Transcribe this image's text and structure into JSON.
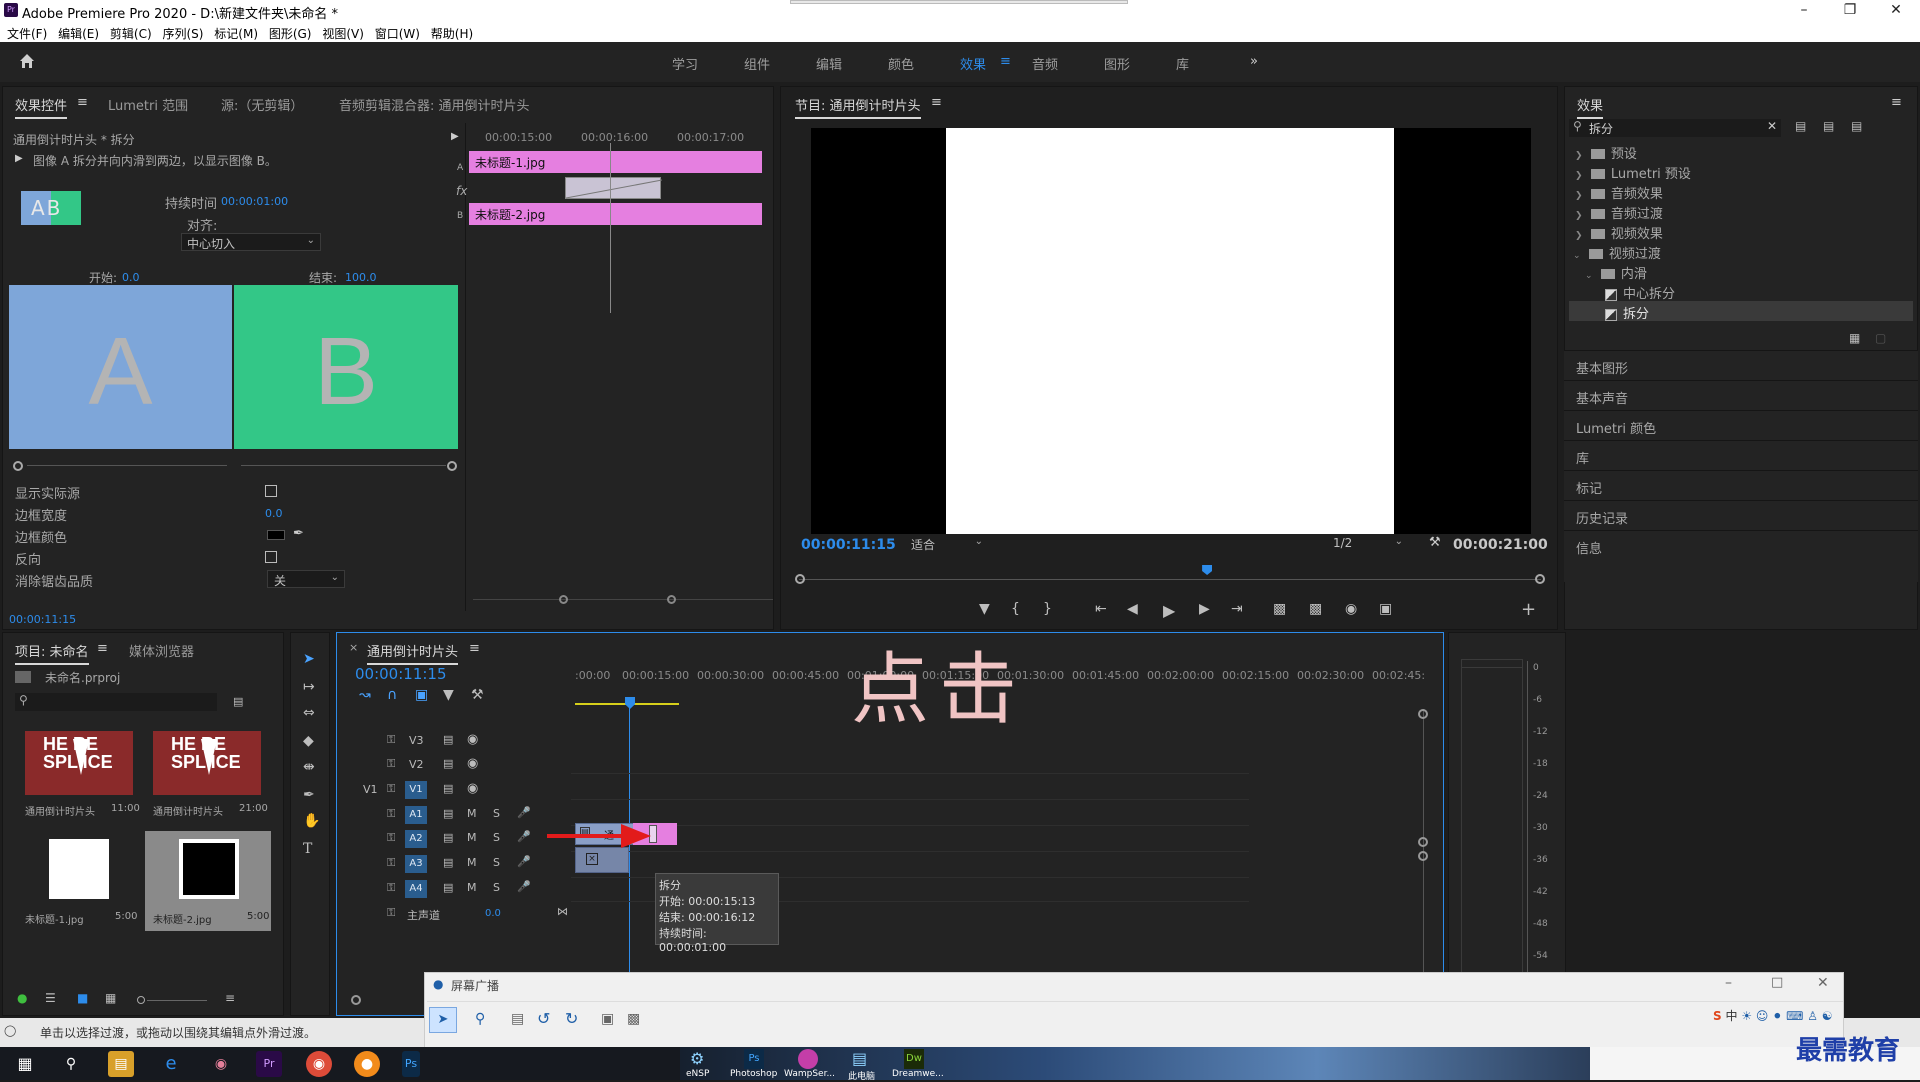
{
  "app": {
    "title": "Adobe Premiere Pro 2020 - D:\\新建文件夹\\未命名 *",
    "logo": "Pr"
  },
  "menu": [
    "文件(F)",
    "编辑(E)",
    "剪辑(C)",
    "序列(S)",
    "标记(M)",
    "图形(G)",
    "视图(V)",
    "窗口(W)",
    "帮助(H)"
  ],
  "workspaces": [
    "学习",
    "组件",
    "编辑",
    "颜色",
    "效果",
    "音频",
    "图形",
    "库"
  ],
  "workspace_more": "»",
  "effect_controls": {
    "tabs": [
      "效果控件",
      "Lumetri 范围",
      "源:（无剪辑）",
      "音频剪辑混合器: 通用倒计时片头"
    ],
    "clip_name": "通用倒计时片头 * 拆分",
    "description": "图像 A 拆分并向内滑到两边，以显示图像 B。",
    "thumb_text": "AB",
    "duration_label": "持续时间",
    "duration_value": "00:00:01:00",
    "align_label": "对齐:",
    "align_value": "中心切入",
    "start_label": "开始:",
    "start_value": "0.0",
    "end_label": "结束:",
    "end_value": "100.0",
    "preview_a": "A",
    "preview_b": "B",
    "ruler": [
      "00:00:15:00",
      "00:00:16:00",
      "00:00:17:00"
    ],
    "clip_a": "未标题-1.jpg",
    "clip_b": "未标题-2.jpg",
    "track_a": "A",
    "track_b": "B",
    "fx": "fx",
    "props": [
      {
        "label": "显示实际源",
        "value": ""
      },
      {
        "label": "边框宽度",
        "value": "0.0"
      },
      {
        "label": "边框颜色",
        "value": ""
      },
      {
        "label": "反向",
        "value": ""
      },
      {
        "label": "消除锯齿品质",
        "value": "关"
      }
    ],
    "timecode": "00:00:11:15"
  },
  "program": {
    "title": "节目: 通用倒计时片头",
    "timecode": "00:00:11:15",
    "fit": "适合",
    "resolution": "1/2",
    "duration": "00:00:21:00",
    "playhead_fraction": 0.55
  },
  "effects_panel": {
    "title": "效果",
    "search_value": "拆分",
    "tree": [
      {
        "label": "预设",
        "level": 0
      },
      {
        "label": "Lumetri 预设",
        "level": 0
      },
      {
        "label": "音频效果",
        "level": 0
      },
      {
        "label": "音频过渡",
        "level": 0
      },
      {
        "label": "视频效果",
        "level": 0
      },
      {
        "label": "视频过渡",
        "level": 0
      },
      {
        "label": "内滑",
        "level": 1
      },
      {
        "label": "中心拆分",
        "level": 2
      },
      {
        "label": "拆分",
        "level": 2
      }
    ],
    "collapsed_panels": [
      "基本图形",
      "基本声音",
      "Lumetri 颜色",
      "库",
      "标记",
      "历史记录",
      "信息"
    ]
  },
  "project": {
    "tabs": [
      "项目: 未命名",
      "媒体浏览器"
    ],
    "file": "未命名.prproj",
    "items": [
      {
        "name": "通用倒计时片头",
        "duration": "11:00"
      },
      {
        "name": "通用倒计时片头",
        "duration": "21:00"
      },
      {
        "name": "未标题-1.jpg",
        "duration": "5:00"
      },
      {
        "name": "未标题-2.jpg",
        "duration": "5:00"
      }
    ]
  },
  "timeline": {
    "tab": "通用倒计时片头",
    "timecode": "00:00:11:15",
    "ruler": [
      ":00:00",
      "00:00:15:00",
      "00:00:30:00",
      "00:00:45:00",
      "00:01:00:00",
      "00:01:15:00",
      "00:01:30:00",
      "00:01:45:00",
      "00:02:00:00",
      "00:02:15:00",
      "00:02:30:00",
      "00:02:45:"
    ],
    "video_tracks": [
      "V3",
      "V2",
      "V1"
    ],
    "audio_tracks": [
      "A1",
      "A2",
      "A3",
      "A4"
    ],
    "source_patch": "V1",
    "master": "主声道",
    "master_value": "0.0",
    "clip_label": "通",
    "overlay_text": "点击",
    "tooltip": {
      "title": "拆分",
      "start": "开始: 00:00:15:13",
      "end": "结束: 00:00:16:12",
      "duration": "持续时间: 00:00:01:00"
    },
    "track_buttons": {
      "m": "M",
      "s": "S"
    }
  },
  "meters": [
    "0",
    "-6",
    "-12",
    "-18",
    "-24",
    "-30",
    "-36",
    "-42",
    "-48",
    "-54"
  ],
  "status": "单击以选择过渡，或拖动以围绕其编辑点外滑过渡。",
  "screencast": {
    "title": "屏幕广播"
  },
  "taskbar": {
    "apps": [
      "eNSP",
      "Photoshop",
      "WampSer...",
      "此电脑",
      "Dreamwe..."
    ],
    "ime": "中",
    "watermark": "最需教育"
  },
  "colors": {
    "accent": "#2d8ceb",
    "clip": "#e57fe0",
    "a_color": "#7ea6d9",
    "b_color": "#33c787"
  }
}
